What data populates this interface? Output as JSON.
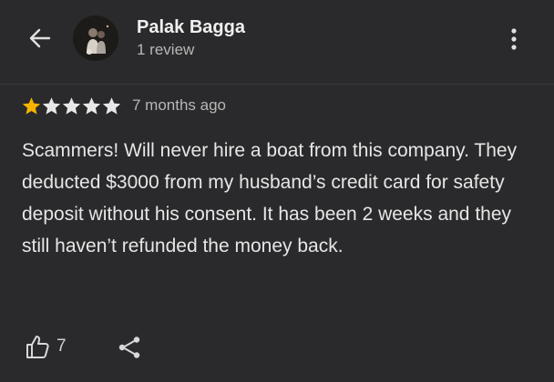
{
  "reviewer": {
    "name": "Palak Bagga",
    "review_count": "1 review"
  },
  "review": {
    "rating": 1,
    "max_rating": 5,
    "time_ago": "7 months ago",
    "text": "Scammers! Will never hire a boat from this company. They deducted $3000 from my husband’s credit card for safety deposit without his consent. It has been 2 weeks and they still haven’t refunded the money back.",
    "likes": "7"
  },
  "icons": {
    "back": "back-arrow-icon",
    "more": "more-vert-icon",
    "like": "thumbs-up-icon",
    "share": "share-icon",
    "star": "star-icon"
  },
  "colors": {
    "background": "#2a2a2c",
    "star_filled": "#f5b400",
    "star_empty": "#e8e8e8",
    "text_primary": "#e6e6e6",
    "text_secondary": "#b7b7b7"
  }
}
